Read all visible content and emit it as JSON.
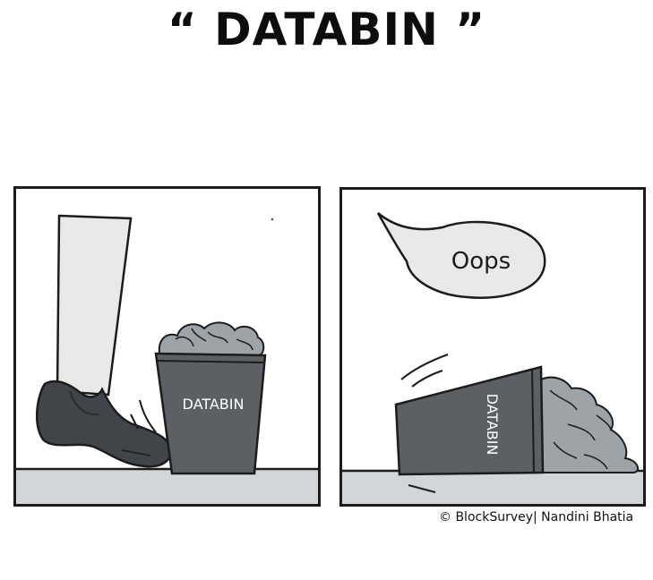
{
  "title": "“ DATABIN ”",
  "panel1": {
    "bin_label": "DATABIN"
  },
  "panel2": {
    "speech": "Oops",
    "bin_label": "DATABIN"
  },
  "credit": "© BlockSurvey| Nandini Bhatia",
  "colors": {
    "bin": "#5c5f63",
    "floor": "#d2d6d8",
    "paper": "#9ea3a8",
    "shoe": "#414448",
    "outline": "#1c1c1c"
  }
}
